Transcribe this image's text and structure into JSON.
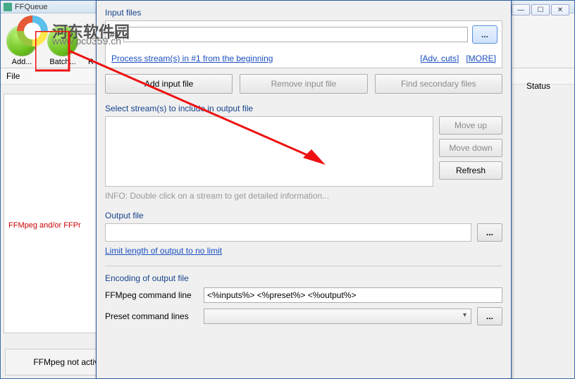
{
  "bg": {
    "title": "FFQueue",
    "toolbar": {
      "add": "Add...",
      "batch": "Batch...",
      "r": "R"
    },
    "col_file": "File",
    "col_status": "Status",
    "error_msg": "FFMpeg and/or FFPr",
    "status": "FFMpeg not active"
  },
  "watermark": {
    "site_cn": "河东软件园",
    "url": "www.pc0359.cn"
  },
  "dlg": {
    "input_label": "Input files",
    "stream_no": "#1",
    "process_link": "Process stream(s) in #1 from the beginning",
    "adv_cuts": "[Adv. cuts]",
    "more": "[MORE]",
    "add_input": "Add input file",
    "remove_input": "Remove input file",
    "find_secondary": "Find secondary files",
    "select_streams": "Select stream(s) to include in output file",
    "move_up": "Move up",
    "move_down": "Move down",
    "refresh": "Refresh",
    "info": "INFO: Double click on a stream to get detailed information...",
    "output_label": "Output file",
    "limit_link": "Limit length of output to no limit",
    "encoding_label": "Encoding of output file",
    "ffmpeg_cmd_label": "FFMpeg command line",
    "ffmpeg_cmd": "<%inputs%> <%preset%> <%output%>",
    "preset_label": "Preset command lines",
    "ellipsis": "..."
  },
  "winctrl": {
    "min": "—",
    "max": "☐",
    "close": "✕"
  }
}
